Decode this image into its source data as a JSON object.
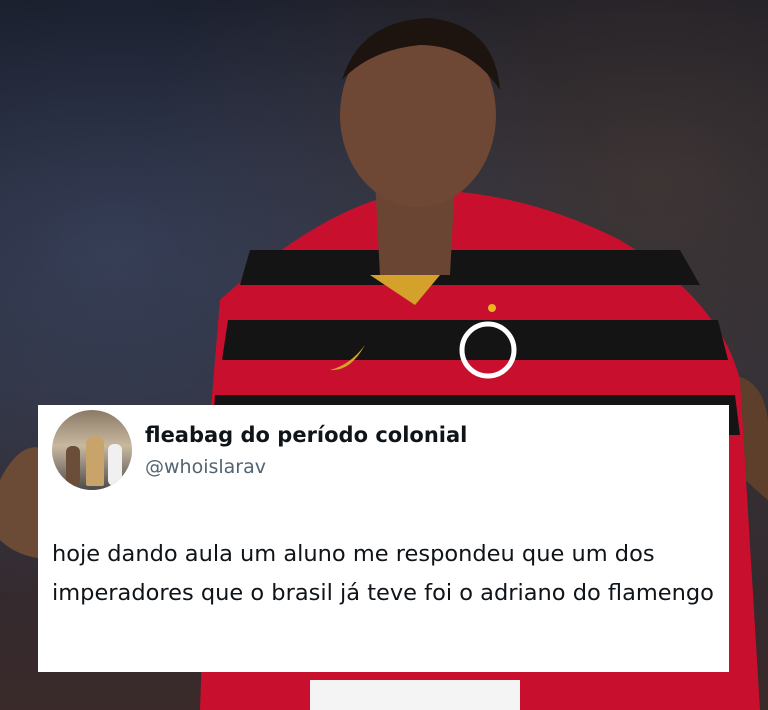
{
  "tweet": {
    "display_name": "fleabag do período colonial",
    "handle": "@whoislarav",
    "text": "hoje dando aula um aluno me respondeu que um dos imperadores que o brasil já teve foi o adriano do flamengo",
    "avatar_icon": "profile-photo"
  },
  "photo": {
    "subject": "football-player-photo",
    "jersey_colors": [
      "#c8102e",
      "#111111"
    ]
  }
}
